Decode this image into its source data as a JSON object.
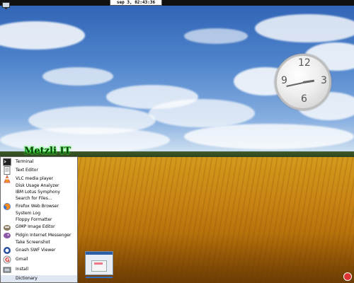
{
  "panel": {
    "clock_text": "sep 3, 02:43:36"
  },
  "desktop": {
    "brand_text": "Metzli IT"
  },
  "analog_clock": {
    "numbers": [
      "12",
      "3",
      "6",
      "9"
    ],
    "hour": 2,
    "minute": 43
  },
  "menu": {
    "items": [
      {
        "label": "Terminal",
        "icon": "terminal-icon"
      },
      {
        "label": "Text Editor",
        "icon": "text-editor-icon"
      },
      {
        "label": "VLC media player",
        "icon": "vlc-icon"
      },
      {
        "label": "Disk Usage Analyzer",
        "icon": ""
      },
      {
        "label": "IBM Lotus Symphony",
        "icon": ""
      },
      {
        "label": "Search for Files...",
        "icon": ""
      },
      {
        "label": "Firefox Web Browser",
        "icon": "firefox-icon"
      },
      {
        "label": "System Log",
        "icon": ""
      },
      {
        "label": "Floppy Formatter",
        "icon": ""
      },
      {
        "label": "GIMP Image Editor",
        "icon": "gimp-icon"
      },
      {
        "label": "Pidgin Internet Messenger",
        "icon": "pidgin-icon"
      },
      {
        "label": "Take Screenshot",
        "icon": ""
      },
      {
        "label": "Gnash SWF Viewer",
        "icon": "gnash-icon"
      },
      {
        "label": "Gmail",
        "icon": "gmail-icon"
      },
      {
        "label": "Install",
        "icon": "install-icon"
      },
      {
        "label": "Dictionary",
        "icon": ""
      }
    ]
  },
  "colors": {
    "panel": "#111111",
    "menu_highlight": "#dfe7f2",
    "brand_glow": "#33ff33"
  }
}
